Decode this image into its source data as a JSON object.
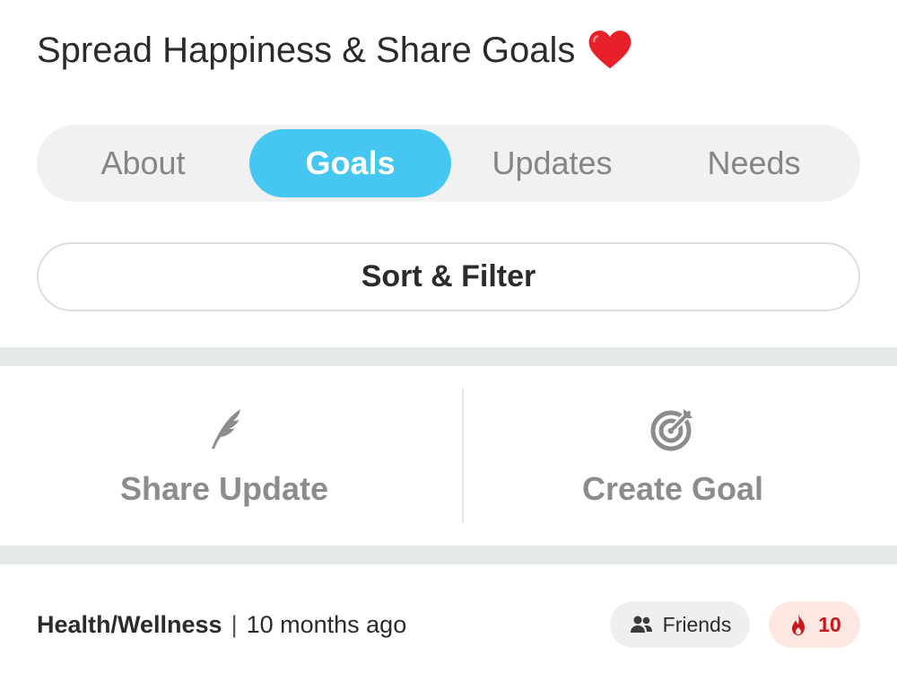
{
  "header": {
    "title": "Spread Happiness & Share Goals",
    "icon": "heart-icon",
    "icon_color": "#e8202a"
  },
  "tabs": [
    {
      "label": "About",
      "active": false
    },
    {
      "label": "Goals",
      "active": true
    },
    {
      "label": "Updates",
      "active": false
    },
    {
      "label": "Needs",
      "active": false
    }
  ],
  "colors": {
    "accent": "#45c7f1",
    "fire": "#c8171b",
    "fire_bg": "#fde7e3",
    "separator": "#e5e9e9"
  },
  "sort_filter": {
    "label": "Sort & Filter"
  },
  "actions": {
    "share_update": {
      "label": "Share Update",
      "icon": "feather-icon"
    },
    "create_goal": {
      "label": "Create Goal",
      "icon": "target-icon"
    }
  },
  "post": {
    "category": "Health/Wellness",
    "separator": "|",
    "time": "10 months ago",
    "visibility": {
      "label": "Friends",
      "icon": "people-icon"
    },
    "streak": {
      "count": "10",
      "icon": "fire-icon"
    }
  }
}
